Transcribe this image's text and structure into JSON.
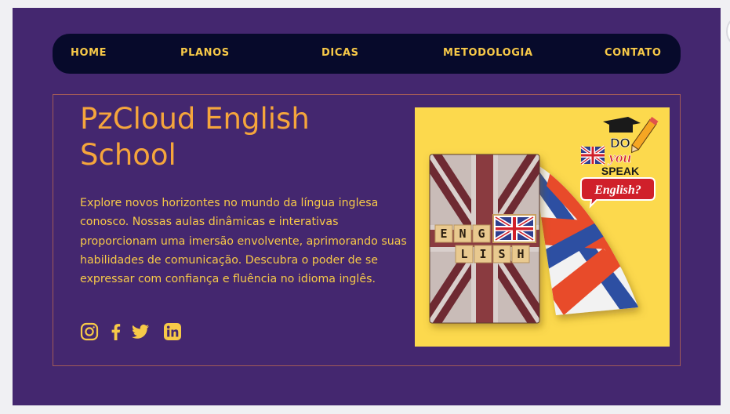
{
  "nav": {
    "items": [
      "HOME",
      "PLANOS",
      "DICAS",
      "METODOLOGIA",
      "CONTATO"
    ]
  },
  "hero": {
    "title": "PzCloud English School",
    "description": "Explore novos horizontes no mundo da língua inglesa conosco. Nossas aulas dinâmicas e interativas proporcionam uma imersão envolvente, aprimorando suas habilidades de comunicação. Descubra o poder de se expressar com confiança e fluência no idioma inglês.",
    "social_icons": [
      "instagram-icon",
      "facebook-icon",
      "twitter-icon",
      "linkedin-icon"
    ]
  },
  "image": {
    "tiles_top": [
      "E",
      "N",
      "G"
    ],
    "tiles_bottom": [
      "L",
      "I",
      "S",
      "H"
    ],
    "sticker": {
      "line1": "DO",
      "line2": "you",
      "line3": "SPEAK",
      "line4": "English?"
    }
  },
  "colors": {
    "background": "#44276f",
    "nav_bg": "#070a2b",
    "accent_yellow": "#f7c948",
    "title_orange": "#f5a53c",
    "image_bg": "#fcd94d"
  }
}
